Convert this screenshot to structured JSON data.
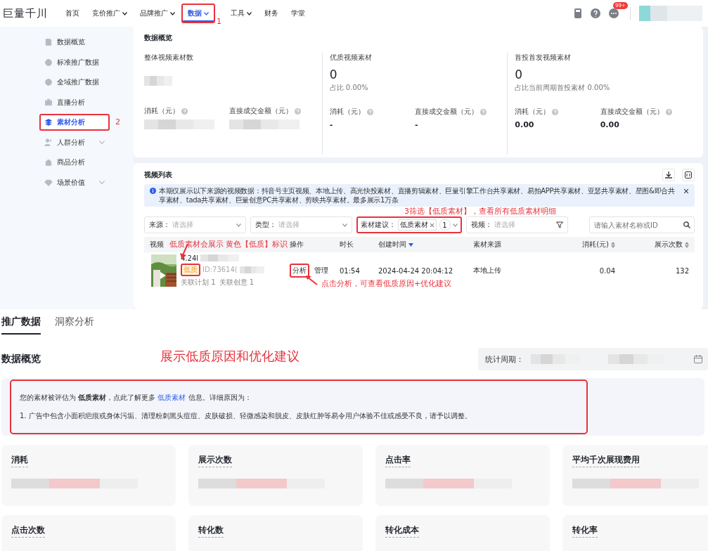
{
  "top_nav": {
    "logo": "巨量千川",
    "items": [
      {
        "label": "首页",
        "dropdown": false,
        "selected": false,
        "annotated": false
      },
      {
        "label": "竞价推广",
        "dropdown": true,
        "selected": false,
        "annotated": false
      },
      {
        "label": "品牌推广",
        "dropdown": true,
        "selected": false,
        "annotated": false
      },
      {
        "label": "数据",
        "dropdown": true,
        "selected": true,
        "annotated": true
      },
      {
        "label": "工具",
        "dropdown": true,
        "selected": false,
        "annotated": false
      },
      {
        "label": "财务",
        "dropdown": false,
        "selected": false,
        "annotated": false
      },
      {
        "label": "学堂",
        "dropdown": false,
        "selected": false,
        "annotated": false
      }
    ],
    "annotation_number": "1",
    "notification_badge": "99+"
  },
  "sidebar": {
    "annotation_number": "2",
    "items": [
      {
        "label": "数据概览",
        "expandable": false,
        "selected": false,
        "annotated": false
      },
      {
        "label": "标准推广数据",
        "expandable": false,
        "selected": false,
        "annotated": false
      },
      {
        "label": "全域推广数据",
        "expandable": false,
        "selected": false,
        "annotated": false
      },
      {
        "label": "直播分析",
        "expandable": false,
        "selected": false,
        "annotated": false
      },
      {
        "label": "素材分析",
        "expandable": false,
        "selected": true,
        "annotated": true
      },
      {
        "label": "人群分析",
        "expandable": true,
        "selected": false,
        "annotated": false
      },
      {
        "label": "商品分析",
        "expandable": false,
        "selected": false,
        "annotated": false
      },
      {
        "label": "场景价值",
        "expandable": true,
        "selected": false,
        "annotated": false
      }
    ]
  },
  "overview": {
    "title": "数据概览",
    "columns": [
      {
        "title": "整体视频素材数",
        "blurred": true,
        "metrics": [
          {
            "label": "消耗（元）",
            "blurred": true
          },
          {
            "label": "直接成交金额（元）",
            "blurred": true
          }
        ]
      },
      {
        "title": "优质视频素材",
        "blurred": false,
        "value": "0",
        "sub": "占比 0.00%",
        "metrics": [
          {
            "label": "消耗（元）",
            "blurred": false,
            "value": "-"
          },
          {
            "label": "直接成交金额（元）",
            "blurred": false,
            "value": "-"
          }
        ]
      },
      {
        "title": "首投首发视频素材",
        "blurred": false,
        "value": "0",
        "sub": "占比当前周期首投素材 0.00%",
        "metrics": [
          {
            "label": "消耗（元）",
            "blurred": false,
            "value": "0.00"
          },
          {
            "label": "直接成交金额（元）",
            "blurred": false,
            "value": "0.00"
          }
        ]
      }
    ]
  },
  "video_list": {
    "title": "视频列表",
    "notice": "本期仅展示以下来源的视频数据：抖音号主页视频、本地上传、高光快投素材、直播剪辑素材、巨量引擎工作台共享素材、易拍APP共享素材、亚瑟共享素材、星图&即合共享素材、tada共享素材、巨量创意PC共享素材、剪映共享素材。最多展示1万条",
    "filter_annotation": "3筛选【低质素材】，查看所有低质素材明细",
    "filters": [
      {
        "kind": "select",
        "label": "来源：",
        "placeholder": "请选择",
        "annotated": false
      },
      {
        "kind": "select",
        "label": "类型：",
        "placeholder": "请选择",
        "annotated": false
      },
      {
        "kind": "tags",
        "label": "素材建议：",
        "tag": "低质素材",
        "count": "1",
        "annotated": true
      },
      {
        "kind": "filter",
        "label": "视频：",
        "placeholder": "请选择",
        "annotated": false
      }
    ],
    "search": {
      "placeholder": "请输入素材名称或ID"
    },
    "columns_annotation": "低质素材会展示 黄色【低质】标识",
    "columns": [
      {
        "label": "视频",
        "sortable": false,
        "sorted": false
      },
      {
        "label": "操作",
        "sortable": false,
        "sorted": false
      },
      {
        "label": "时长",
        "sortable": false,
        "sorted": false
      },
      {
        "label": "创建时间",
        "sortable": true,
        "sorted": true
      },
      {
        "label": "素材来源",
        "sortable": false,
        "sorted": false
      },
      {
        "label": "消耗(元)",
        "sortable": true,
        "sorted": false
      },
      {
        "label": "展示次数",
        "sortable": true,
        "sorted": false
      }
    ],
    "action_annotation": "点击分析，可查看低质原因+优化建议",
    "rows": [
      {
        "title": "4.24l",
        "badge": "低质",
        "badge_annotated": true,
        "id": "ID:73614(",
        "plans": "关联计划 1",
        "creatives": "关联创意 1",
        "actions": [
          {
            "label": "分析",
            "annotated": true
          },
          {
            "label": "管理",
            "annotated": false
          }
        ],
        "duration": "01:54",
        "created": "2024-04-24 20:04:12",
        "source": "本地上传",
        "cost": "0.04",
        "impressions": "132"
      }
    ]
  },
  "detail": {
    "tabs": [
      {
        "label": "推广数据",
        "selected": true
      },
      {
        "label": "洞察分析",
        "selected": false
      }
    ],
    "title": "数据概览",
    "annotation": "展示低质原因和优化建议",
    "period_label": "统计周期：",
    "notice": {
      "annotated": true,
      "before": "您的素材被评估为 **低质素材**，点此了解更多 ",
      "link": "低质素材",
      "after": " 信息。详细原因为：",
      "reason": "1. 广告中包含小面积疤痕或身体污垢、清理粉刺黑头痘痘、皮肤破损、轻微感染和脱皮、皮肤红肿等易令用户体验不佳或感受不良，请予以调整。"
    },
    "metrics": [
      {
        "label": "消耗",
        "blurred": true
      },
      {
        "label": "展示次数",
        "blurred": true
      },
      {
        "label": "点击率",
        "blurred": true
      },
      {
        "label": "平均千次展现费用",
        "blurred": true
      },
      {
        "label": "点击次数",
        "blurred": false
      },
      {
        "label": "转化数",
        "blurred": false
      },
      {
        "label": "转化成本",
        "blurred": false
      },
      {
        "label": "转化率",
        "blurred": false
      }
    ]
  }
}
